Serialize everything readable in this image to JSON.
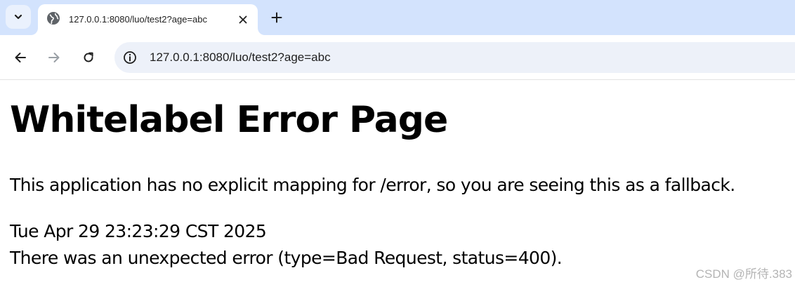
{
  "browser": {
    "tab": {
      "title": "127.0.0.1:8080/luo/test2?age=abc",
      "favicon": "globe-icon"
    },
    "omnibox": {
      "url": "127.0.0.1:8080/luo/test2?age=abc"
    },
    "icons": {
      "tab_search": "chevron-down-icon",
      "tab_close": "close-icon",
      "new_tab": "plus-icon",
      "back": "arrow-left-icon",
      "forward": "arrow-right-icon",
      "reload": "reload-icon",
      "site_info": "info-icon"
    },
    "colors": {
      "tabstrip": "#d3e3fd",
      "omnibox": "#edf1f9",
      "forward_disabled": "#9aa0a6"
    }
  },
  "page": {
    "title": "Whitelabel Error Page",
    "description": "This application has no explicit mapping for /error, so you are seeing this as a fallback.",
    "timestamp": "Tue Apr 29 23:23:29 CST 2025",
    "error_detail": "There was an unexpected error (type=Bad Request, status=400)."
  },
  "watermark": "CSDN @所待.383"
}
